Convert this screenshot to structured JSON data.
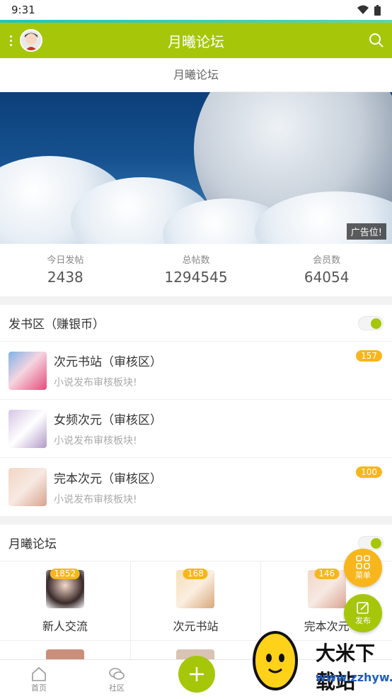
{
  "status_bar": {
    "time": "9:31"
  },
  "title_bar": {
    "title": "月曦论坛"
  },
  "sub_header": {
    "title": "月曦论坛"
  },
  "banner": {
    "ad_label": "广告位!"
  },
  "stats": [
    {
      "label": "今日发帖",
      "value": "2438"
    },
    {
      "label": "总帖数",
      "value": "1294545"
    },
    {
      "label": "会员数",
      "value": "64054"
    }
  ],
  "section_books": {
    "title": "发书区（赚银币）",
    "forums": [
      {
        "name": "次元书站（审核区）",
        "desc": "小说发布审核板块!",
        "badge": "157"
      },
      {
        "name": "女频次元（审核区）",
        "desc": "小说发布审核板块!",
        "badge": ""
      },
      {
        "name": "完本次元（审核区）",
        "desc": "小说发布审核板块!",
        "badge": "100"
      }
    ]
  },
  "section_forum": {
    "title": "月曦论坛",
    "cells": [
      {
        "name": "新人交流",
        "badge": "1852"
      },
      {
        "name": "次元书站",
        "badge": "168"
      },
      {
        "name": "完本次元",
        "badge": "146"
      }
    ]
  },
  "fab": {
    "menu_label": "菜单",
    "post_label": "发布"
  },
  "bottom_nav": {
    "home": "首页",
    "community": "社区"
  },
  "watermark": {
    "brand": "大米下载站",
    "url": "www.zzhyw.com"
  },
  "colors": {
    "accent": "#a6c60a",
    "badge": "#f7b61c"
  }
}
